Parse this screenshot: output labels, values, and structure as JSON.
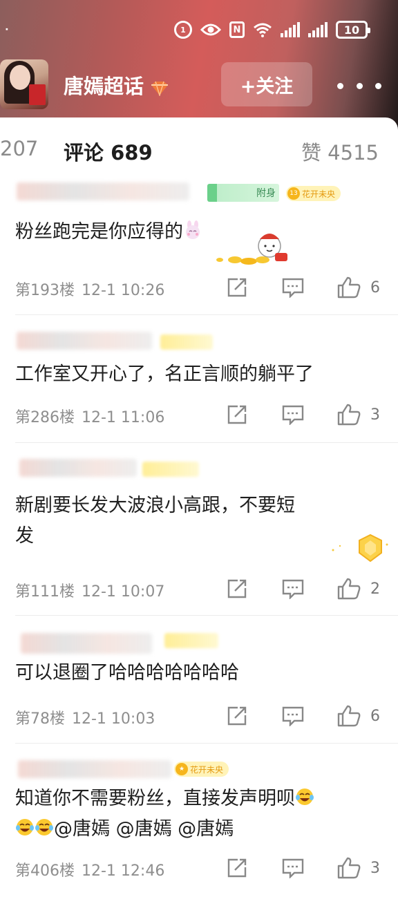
{
  "status_bar": {
    "dots": "⠂",
    "battery": "10"
  },
  "header": {
    "topic_title": "唐嫣超话",
    "follow_button": "+关注"
  },
  "tabs": {
    "reposts": "207",
    "comments": "评论 689",
    "likes": "赞 4515"
  },
  "colors": {
    "header_gradient_mid": "#d45c5a",
    "meta_gray": "#8e8e8e",
    "text_dark": "#1e1e1e",
    "badge_yellow": "#fff3b8"
  },
  "badges": {
    "fan_badge": "附身",
    "level_badge": "花开未央",
    "level_badge_number": "13",
    "level_badge_5": "花开未央"
  },
  "comments": [
    {
      "text": "粉丝跑完是你应得的",
      "floor": "第193楼",
      "time": "12-1 10:26",
      "likes": "6"
    },
    {
      "text": "工作室又开心了，名正言顺的躺平了",
      "floor": "第286楼",
      "time": "12-1 11:06",
      "likes": "3"
    },
    {
      "text_line1": "新剧要长发大波浪小高跟，不要短",
      "text_line2": "发",
      "floor": "第111楼",
      "time": "12-1 10:07",
      "likes": "2"
    },
    {
      "text": "可以退圈了哈哈哈哈哈哈哈",
      "floor": "第78楼",
      "time": "12-1 10:03",
      "likes": "6"
    },
    {
      "text_line1": "知道你不需要粉丝，直接发声明呗",
      "text_line2_mentions": "@唐嫣 @唐嫣 @唐嫣",
      "floor": "第406楼",
      "time": "12-1 12:46",
      "likes": "3"
    }
  ],
  "icons": {
    "share": "share-icon",
    "reply": "comment-icon",
    "like": "thumbs-up-icon"
  }
}
